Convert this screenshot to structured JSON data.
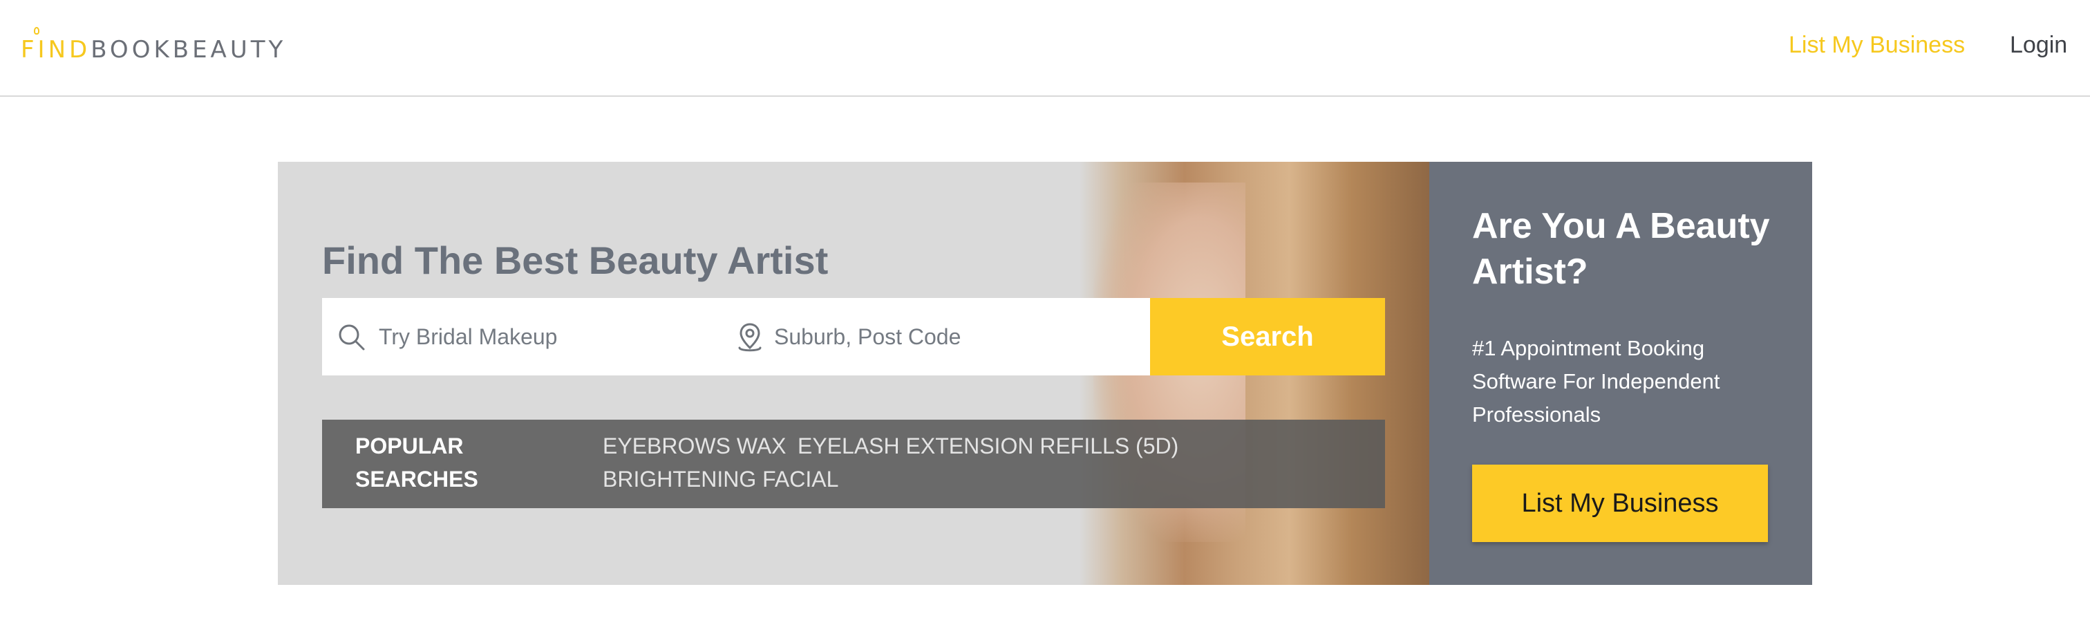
{
  "header": {
    "logo": {
      "find": "FIND",
      "rest": "BOOKBEAUTY"
    },
    "nav": {
      "list_business": "List My Business",
      "login": "Login"
    }
  },
  "hero": {
    "title": "Find The Best Beauty Artist",
    "search": {
      "keyword_placeholder": "Try Bridal Makeup",
      "location_placeholder": "Suburb, Post Code",
      "button_label": "Search"
    },
    "popular": {
      "label": "POPULAR SEARCHES",
      "tags": [
        "EYEBROWS WAX",
        "EYELASH EXTENSION REFILLS (5D)",
        "BRIGHTENING FACIAL"
      ]
    }
  },
  "promo": {
    "title": "Are You A Beauty Artist?",
    "text": "#1 Appointment Booking Software For Independent Professionals",
    "button_label": "List My Business"
  },
  "colors": {
    "accent": "#fdca26",
    "promo_bg": "#6b717c",
    "title_gray": "#6a717c"
  },
  "icons": {
    "keyword": "search-icon",
    "location": "location-pin-icon"
  }
}
